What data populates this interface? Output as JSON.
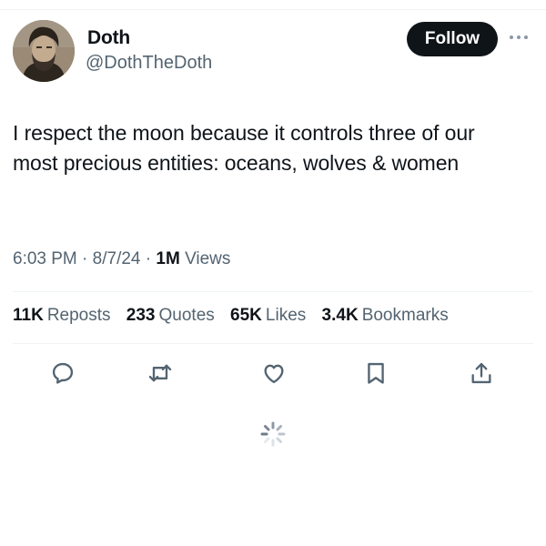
{
  "author": {
    "name": "Doth",
    "handle": "@DothTheDoth",
    "avatar_icon": "profile-portrait"
  },
  "follow_label": "Follow",
  "tweet": {
    "text": "I respect the moon because it controls three of our most precious entities: oceans, wolves & women"
  },
  "meta": {
    "time": "6:03 PM",
    "date": "8/7/24",
    "views_count": "1M",
    "views_label": "Views"
  },
  "stats": {
    "reposts_count": "11K",
    "reposts_label": "Reposts",
    "quotes_count": "233",
    "quotes_label": "Quotes",
    "likes_count": "65K",
    "likes_label": "Likes",
    "bookmarks_count": "3.4K",
    "bookmarks_label": "Bookmarks"
  },
  "actions": [
    "reply-icon",
    "repost-icon",
    "like-icon",
    "bookmark-icon",
    "share-icon"
  ],
  "colors": {
    "text": "#0f1419",
    "secondary": "#536471",
    "divider": "#eff3f4",
    "button_bg": "#0f1419"
  }
}
